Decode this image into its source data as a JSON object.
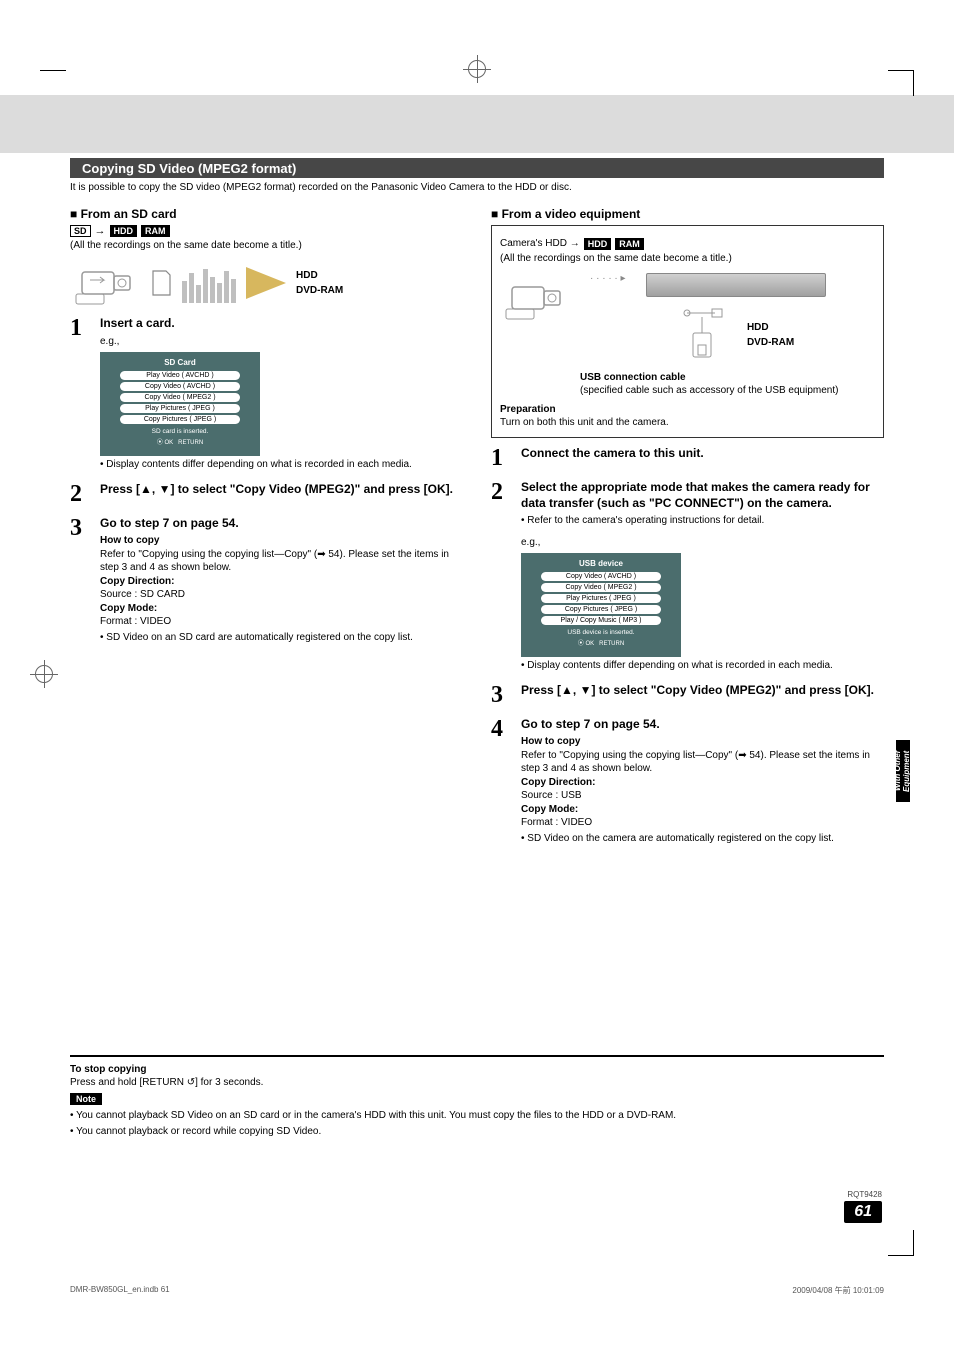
{
  "section_title": "Copying SD Video (MPEG2 format)",
  "intro": "It is possible to copy the SD video (MPEG2 format) recorded on the Panasonic Video Camera to the HDD or disc.",
  "left": {
    "heading": "From an SD card",
    "badges": {
      "sd": "SD",
      "arrow": "→",
      "hdd": "HDD",
      "ram": "RAM"
    },
    "badge_note": "(All the recordings on the same date become a title.)",
    "media": {
      "hdd": "HDD",
      "dvdram": "DVD-RAM"
    },
    "step1": {
      "title": "Insert a card.",
      "eg": "e.g.,"
    },
    "dialog": {
      "title": "SD Card",
      "opt1": "Play Video ( AVCHD )",
      "opt2": "Copy Video ( AVCHD )",
      "opt3": "Copy Video ( MPEG2 )",
      "opt4": "Play Pictures ( JPEG )",
      "opt5": "Copy Pictures ( JPEG )",
      "footer": "SD card is inserted.",
      "ok": "OK",
      "return": "RETURN"
    },
    "step1_note": "Display contents differ depending on what is recorded in each media.",
    "step2": {
      "title": "Press [▲, ▼] to select \"Copy Video (MPEG2)\" and press [OK]."
    },
    "step3": {
      "title": "Go to step 7 on page 54.",
      "howto_h": "How to copy",
      "howto": "Refer to \"Copying using the copying list—Copy\" (➡ 54). Please set the items in step 3 and 4 as shown below.",
      "cd_h": "Copy Direction:",
      "cd": "Source : SD CARD",
      "cm_h": "Copy Mode:",
      "cm": "Format : VIDEO",
      "note": "SD Video on an SD card are automatically registered on the copy list."
    }
  },
  "right": {
    "heading": "From a video equipment",
    "badge_prefix": "Camera's HDD →",
    "badges": {
      "hdd": "HDD",
      "ram": "RAM"
    },
    "badge_note": "(All the recordings on the same date become a title.)",
    "media": {
      "hdd": "HDD",
      "dvdram": "DVD-RAM"
    },
    "usb_h": "USB connection cable",
    "usb_note": "(specified cable such as accessory of the USB equipment)",
    "prep_h": "Preparation",
    "prep": "Turn on both this unit and the camera.",
    "step1": {
      "title": "Connect the camera to this unit."
    },
    "step2": {
      "title": "Select the appropriate mode that makes the camera ready for data transfer (such as \"PC CONNECT\") on the camera.",
      "note": "Refer to the camera's operating instructions for detail.",
      "eg": "e.g.,"
    },
    "dialog": {
      "title": "USB device",
      "opt1": "Copy Video ( AVCHD )",
      "opt2": "Copy Video ( MPEG2 )",
      "opt3": "Play Pictures ( JPEG )",
      "opt4": "Copy Pictures ( JPEG )",
      "opt5": "Play / Copy Music ( MP3 )",
      "footer": "USB device is inserted.",
      "ok": "OK",
      "return": "RETURN"
    },
    "step2_note": "Display contents differ depending on what is recorded in each media.",
    "step3": {
      "title": "Press [▲, ▼] to select \"Copy Video (MPEG2)\" and press [OK]."
    },
    "step4": {
      "title": "Go to step 7 on page 54.",
      "howto_h": "How to copy",
      "howto": "Refer to \"Copying using the copying list—Copy\" (➡ 54). Please set the items in step 3 and 4 as shown below.",
      "cd_h": "Copy Direction:",
      "cd": "Source : USB",
      "cm_h": "Copy Mode:",
      "cm": "Format : VIDEO",
      "note": "SD Video on the camera are automatically registered on the copy list."
    }
  },
  "stop": {
    "h": "To stop copying",
    "text": "Press and hold [RETURN ↺] for 3 seconds.",
    "note_label": "Note",
    "n1": "You cannot playback SD Video on an SD card or in the camera's HDD with this unit. You must copy the files to the HDD or a DVD-RAM.",
    "n2": "You cannot playback or record while copying SD Video."
  },
  "side_tab": "With Other Equipment",
  "rqt": "RQT9428",
  "page": "61",
  "footer_left": "DMR-BW850GL_en.indb   61",
  "footer_right": "2009/04/08   午前 10:01:09"
}
